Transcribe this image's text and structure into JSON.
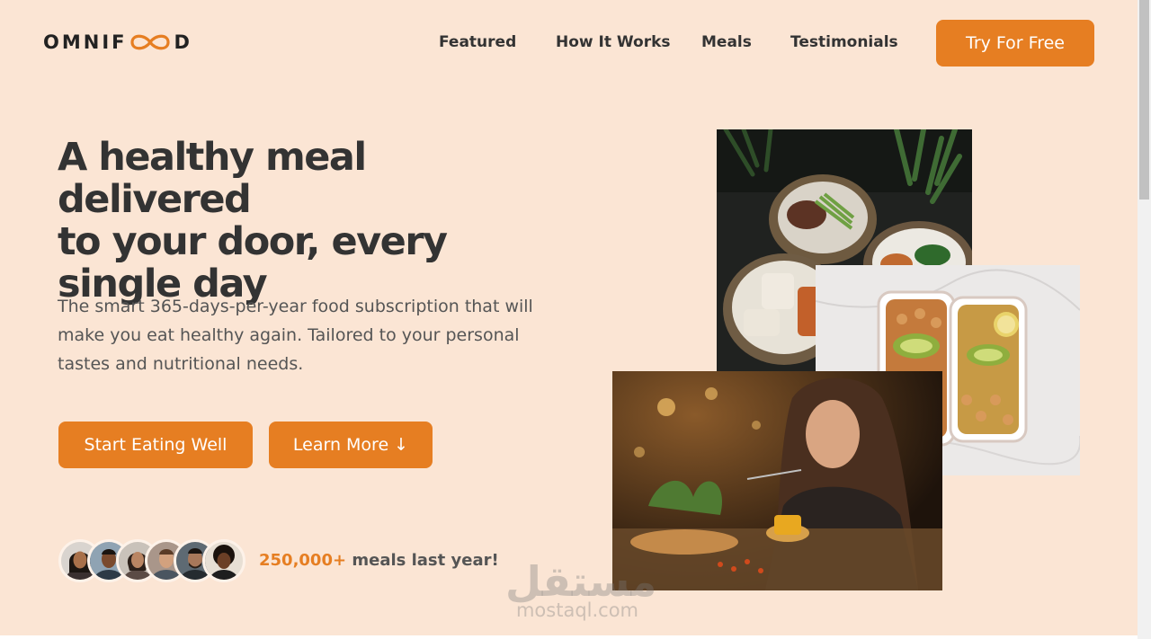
{
  "header": {
    "logo_left": "OMNIF",
    "logo_right": "D",
    "nav": [
      "Featured",
      "How It Works",
      "Meals",
      "Testimonials"
    ],
    "cta": "Try For Free"
  },
  "hero": {
    "title_lines": [
      "A healthy meal delivered",
      "to your door, every",
      "single day"
    ],
    "description": "The smart 365-days-per-year food subscription that will make you eat healthy again. Tailored to your personal tastes and nutritional needs.",
    "primary_button": "Start Eating Well",
    "secondary_button": "Learn More ↓",
    "stat_number": "250,000+",
    "stat_text": "meals last year!"
  },
  "watermark": {
    "arabic": "مستقل",
    "latin": "mostaql.com"
  },
  "colors": {
    "background": "#fbe5d4",
    "accent": "#e67e22",
    "text": "#333333"
  }
}
